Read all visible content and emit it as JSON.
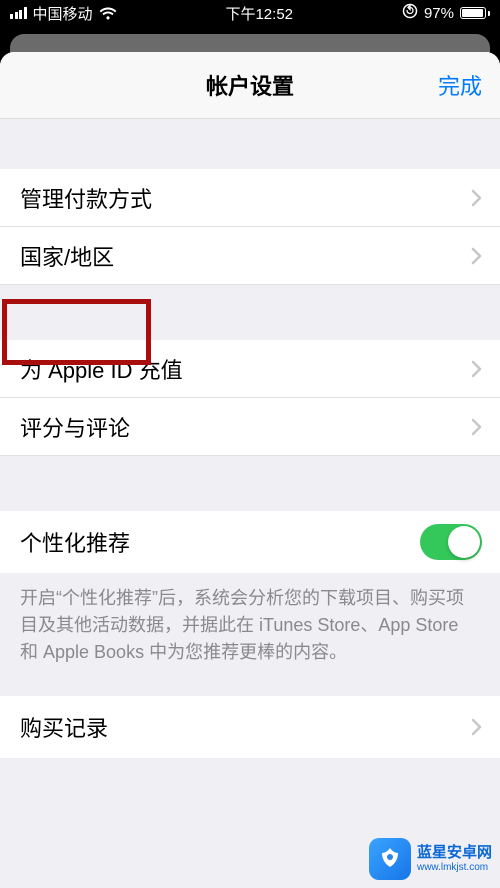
{
  "status_bar": {
    "carrier": "中国移动",
    "time": "下午12:52",
    "battery_percent": "97%",
    "orientation_lock": true
  },
  "nav": {
    "title": "帐户设置",
    "done": "完成"
  },
  "cells": {
    "manage_payment": "管理付款方式",
    "country_region": "国家/地区",
    "add_funds": "为 Apple ID 充值",
    "ratings_reviews": "评分与评论",
    "personalized": "个性化推荐",
    "purchase_history": "购买记录"
  },
  "toggles": {
    "personalized_on": true
  },
  "footer": {
    "personalized": "开启“个性化推荐”后，系统会分析您的下载项目、购买项目及其他活动数据，并据此在 iTunes Store、App Store 和 Apple Books 中为您推荐更棒的内容。"
  },
  "watermark": {
    "title": "蓝星安卓网",
    "url": "www.lmkjst.com"
  }
}
